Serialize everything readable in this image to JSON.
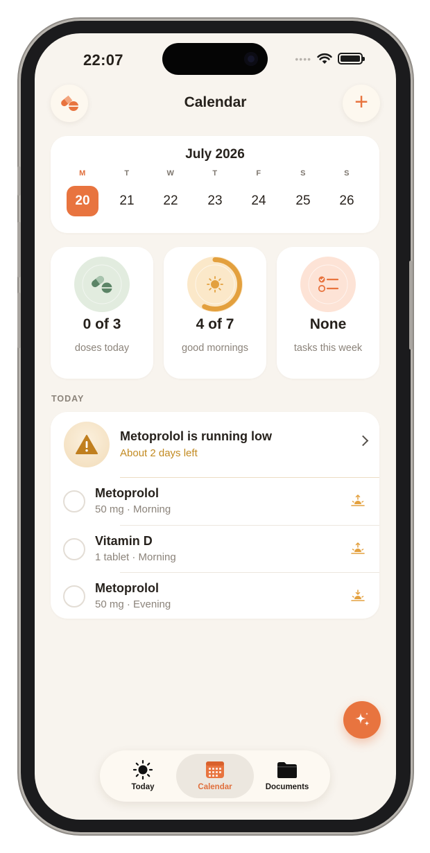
{
  "status_bar": {
    "time": "22:07",
    "signal_dots": "••••"
  },
  "header": {
    "title": "Calendar",
    "left_icon": "pills-icon",
    "right_icon": "plus-icon",
    "plus_glyph": "+"
  },
  "calendar": {
    "month_label": "July 2026",
    "days": [
      {
        "dow": "M",
        "num": "20",
        "selected": true
      },
      {
        "dow": "T",
        "num": "21"
      },
      {
        "dow": "W",
        "num": "22"
      },
      {
        "dow": "T",
        "num": "23"
      },
      {
        "dow": "F",
        "num": "24"
      },
      {
        "dow": "S",
        "num": "25"
      },
      {
        "dow": "S",
        "num": "26"
      }
    ]
  },
  "stats": [
    {
      "value": "0 of 3",
      "label": "doses today",
      "icon": "pills-icon",
      "color": "#e2ecdf"
    },
    {
      "value": "4 of 7",
      "label": "good mornings",
      "icon": "sun-icon",
      "color": "#fbe8c9",
      "progress": 0.57,
      "ring_color": "#e3a03e"
    },
    {
      "value": "None",
      "label": "tasks this week",
      "icon": "checklist-icon",
      "color": "#fde3d6"
    }
  ],
  "today": {
    "section_label": "TODAY",
    "alert": {
      "title": "Metoprolol is running low",
      "subtitle": "About 2 days left",
      "icon": "warning-icon"
    },
    "doses": [
      {
        "name": "Metoprolol",
        "detail": "50 mg · Morning",
        "icon": "sunrise-icon"
      },
      {
        "name": "Vitamin D",
        "detail": "1 tablet · Morning",
        "icon": "sunrise-icon"
      },
      {
        "name": "Metoprolol",
        "detail": "50 mg · Evening",
        "icon": "sunset-icon"
      }
    ]
  },
  "tabs": [
    {
      "label": "Today",
      "icon": "sun-icon"
    },
    {
      "label": "Calendar",
      "icon": "calendar-icon",
      "active": true
    },
    {
      "label": "Documents",
      "icon": "folder-icon"
    }
  ],
  "colors": {
    "accent": "#e8743f",
    "background": "#f8f4ee",
    "warning": "#c28a21"
  }
}
